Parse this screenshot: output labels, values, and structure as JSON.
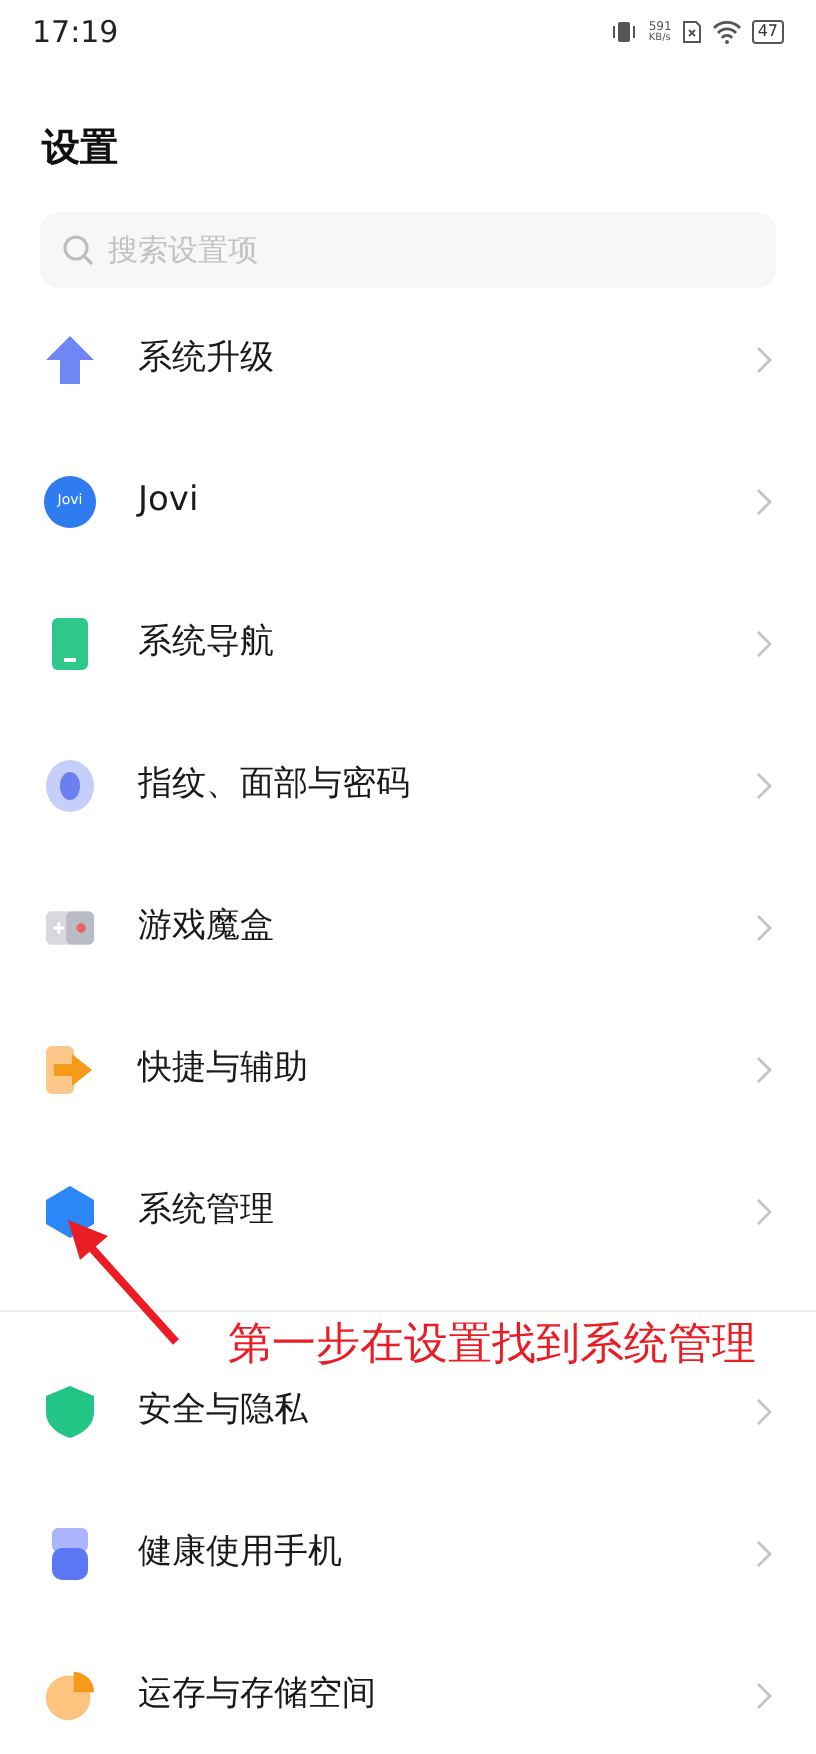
{
  "status_bar": {
    "time": "17:19",
    "speed_value": "591",
    "speed_unit": "KB/s",
    "battery": "47"
  },
  "title": "设置",
  "search": {
    "placeholder": "搜索设置项"
  },
  "sections": [
    {
      "items": [
        {
          "kind": "upgrade",
          "label": "系统升级"
        },
        {
          "kind": "jovi",
          "label": "Jovi",
          "icon_text": "Jovi"
        },
        {
          "kind": "navigation",
          "label": "系统导航"
        },
        {
          "kind": "fingerprint",
          "label": "指纹、面部与密码"
        },
        {
          "kind": "game",
          "label": "游戏魔盒"
        },
        {
          "kind": "shortcut",
          "label": "快捷与辅助"
        },
        {
          "kind": "system",
          "label": "系统管理"
        }
      ]
    },
    {
      "items": [
        {
          "kind": "security",
          "label": "安全与隐私"
        },
        {
          "kind": "health",
          "label": "健康使用手机"
        },
        {
          "kind": "storage",
          "label": "运存与存储空间"
        }
      ]
    }
  ],
  "annotation": {
    "text": "第一步在设置找到系统管理"
  }
}
